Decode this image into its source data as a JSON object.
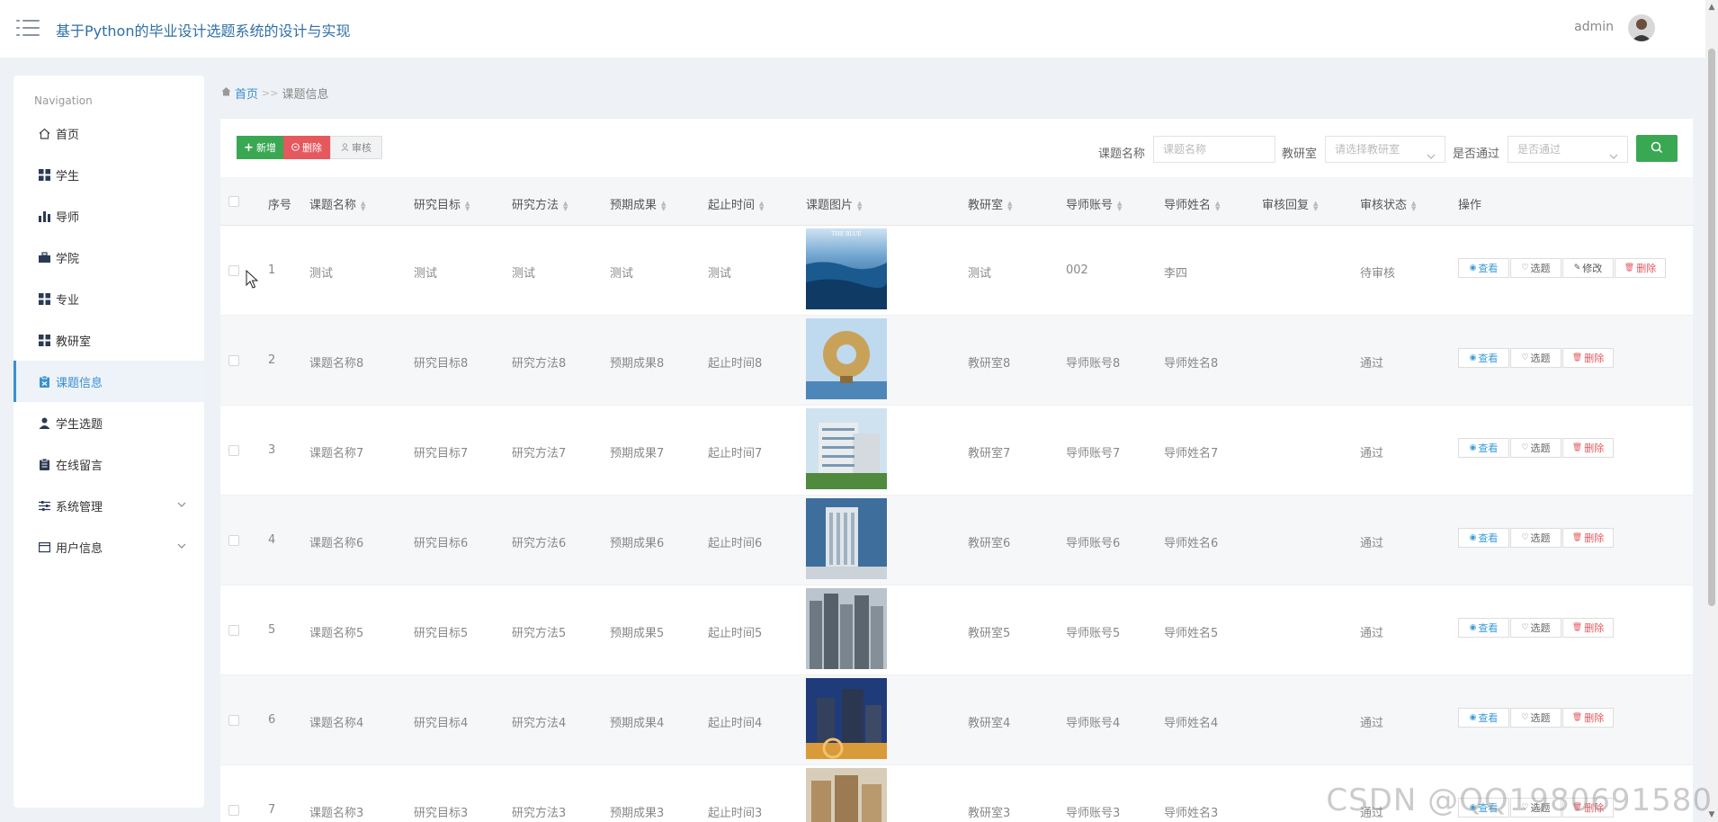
{
  "header": {
    "title": "基于Python的毕业设计选题系统的设计与实现",
    "user": "admin"
  },
  "sidebar": {
    "heading": "Navigation",
    "items": [
      {
        "label": "首页",
        "icon": "home-icon"
      },
      {
        "label": "学生",
        "icon": "grid-icon"
      },
      {
        "label": "导师",
        "icon": "bar-chart-icon"
      },
      {
        "label": "学院",
        "icon": "briefcase-icon"
      },
      {
        "label": "专业",
        "icon": "grid-icon"
      },
      {
        "label": "教研室",
        "icon": "grid-icon"
      },
      {
        "label": "课题信息",
        "icon": "clipboard-icon",
        "active": true
      },
      {
        "label": "学生选题",
        "icon": "user-icon"
      },
      {
        "label": "在线留言",
        "icon": "clipboard-icon"
      },
      {
        "label": "系统管理",
        "icon": "sliders-icon",
        "expandable": true
      },
      {
        "label": "用户信息",
        "icon": "window-icon",
        "expandable": true
      }
    ]
  },
  "breadcrumb": {
    "home": "首页",
    "separator": ">>",
    "current": "课题信息"
  },
  "toolbar": {
    "add_label": "新增",
    "delete_label": "删除",
    "audit_label": "审核"
  },
  "filters": {
    "name_label": "课题名称",
    "name_placeholder": "课题名称",
    "room_label": "教研室",
    "room_placeholder": "请选择教研室",
    "pass_label": "是否通过",
    "pass_placeholder": "是否通过"
  },
  "table": {
    "columns": [
      "序号",
      "课题名称",
      "研究目标",
      "研究方法",
      "预期成果",
      "起止时间",
      "课题图片",
      "教研室",
      "导师账号",
      "导师姓名",
      "审核回复",
      "审核状态",
      "操作"
    ],
    "actions": {
      "view": "查看",
      "pick": "选题",
      "edit": "修改",
      "delete": "删除"
    },
    "rows": [
      {
        "no": "1",
        "name": "测试",
        "goal": "测试",
        "method": "测试",
        "result": "测试",
        "period": "测试",
        "image": "ocean-photo",
        "room": "测试",
        "tutor_id": "002",
        "tutor_name": "李四",
        "reply": "",
        "status": "待审核",
        "editable": true
      },
      {
        "no": "2",
        "name": "课题名称8",
        "goal": "研究目标8",
        "method": "研究方法8",
        "result": "预期成果8",
        "period": "起止时间8",
        "image": "ring-building-photo",
        "room": "教研室8",
        "tutor_id": "导师账号8",
        "tutor_name": "导师姓名8",
        "reply": "",
        "status": "通过"
      },
      {
        "no": "3",
        "name": "课题名称7",
        "goal": "研究目标7",
        "method": "研究方法7",
        "result": "预期成果7",
        "period": "起止时间7",
        "image": "apartment-photo",
        "room": "教研室7",
        "tutor_id": "导师账号7",
        "tutor_name": "导师姓名7",
        "reply": "",
        "status": "通过"
      },
      {
        "no": "4",
        "name": "课题名称6",
        "goal": "研究目标6",
        "method": "研究方法6",
        "result": "预期成果6",
        "period": "起止时间6",
        "image": "office-tower-photo",
        "room": "教研室6",
        "tutor_id": "导师账号6",
        "tutor_name": "导师姓名6",
        "reply": "",
        "status": "通过"
      },
      {
        "no": "5",
        "name": "课题名称5",
        "goal": "研究目标5",
        "method": "研究方法5",
        "result": "预期成果5",
        "period": "起止时间5",
        "image": "skyline-photo",
        "room": "教研室5",
        "tutor_id": "导师账号5",
        "tutor_name": "导师姓名5",
        "reply": "",
        "status": "通过"
      },
      {
        "no": "6",
        "name": "课题名称4",
        "goal": "研究目标4",
        "method": "研究方法4",
        "result": "预期成果4",
        "period": "起止时间4",
        "image": "night-city-photo",
        "room": "教研室4",
        "tutor_id": "导师账号4",
        "tutor_name": "导师姓名4",
        "reply": "",
        "status": "通过"
      },
      {
        "no": "7",
        "name": "课题名称3",
        "goal": "研究目标3",
        "method": "研究方法3",
        "result": "预期成果3",
        "period": "起止时间3",
        "image": "residential-photo",
        "room": "教研室3",
        "tutor_id": "导师账号3",
        "tutor_name": "导师姓名3",
        "reply": "",
        "status": "通过"
      }
    ]
  },
  "watermark": "CSDN @QQ1980691580",
  "colors": {
    "accent": "#3b8fd0",
    "success": "#3aa853",
    "danger": "#e4585e"
  }
}
